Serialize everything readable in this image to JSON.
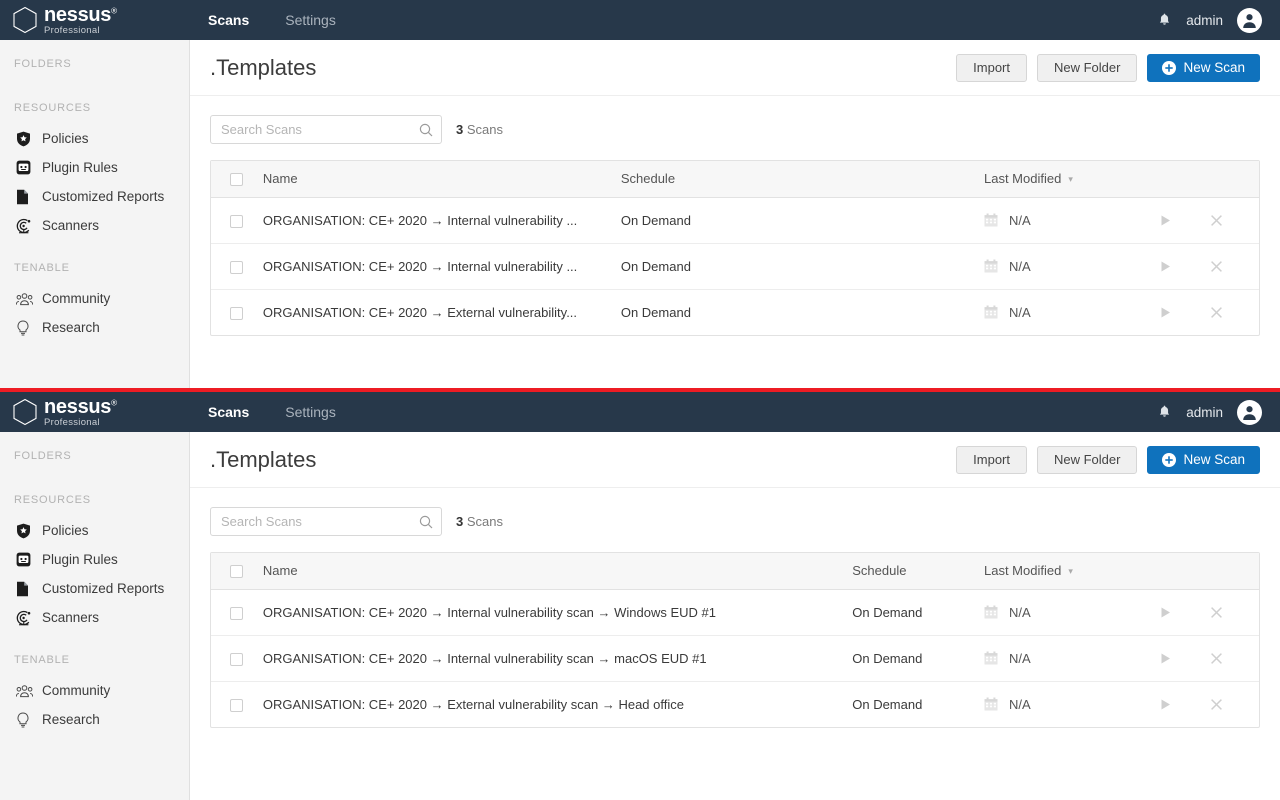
{
  "brand": {
    "name": "nessus",
    "registered": "®",
    "subtitle": "Professional"
  },
  "navbar": {
    "tabs": [
      {
        "label": "Scans",
        "active": true
      },
      {
        "label": "Settings",
        "active": false
      }
    ],
    "notifications_icon": "bell-icon",
    "username": "admin",
    "avatar_icon": "user-avatar-icon"
  },
  "sidebar": {
    "groups": [
      {
        "label": "FOLDERS",
        "items": []
      },
      {
        "label": "RESOURCES",
        "items": [
          {
            "label": "Policies",
            "icon": "shield-star-icon"
          },
          {
            "label": "Plugin Rules",
            "icon": "plugin-rules-icon"
          },
          {
            "label": "Customized Reports",
            "icon": "document-icon"
          },
          {
            "label": "Scanners",
            "icon": "scanner-radar-icon"
          }
        ]
      },
      {
        "label": "TENABLE",
        "items": [
          {
            "label": "Community",
            "icon": "community-people-icon"
          },
          {
            "label": "Research",
            "icon": "lightbulb-icon"
          }
        ]
      }
    ]
  },
  "page": {
    "title": ".Templates",
    "buttons": {
      "import": "Import",
      "new_folder": "New Folder",
      "new_scan": "New Scan"
    }
  },
  "toolbar": {
    "search_placeholder": "Search Scans",
    "search_value": "",
    "search_icon": "search-icon",
    "count_number": "3",
    "count_label": "Scans"
  },
  "table": {
    "columns": {
      "name": "Name",
      "schedule": "Schedule",
      "last_modified": "Last Modified",
      "sort_indicator": "▾"
    },
    "rows_truncated": [
      {
        "name": "ORGANISATION: CE+ 2020 → Internal vulnerability ...",
        "schedule": "On Demand",
        "last_modified": "N/A"
      },
      {
        "name": "ORGANISATION: CE+ 2020 → Internal vulnerability ...",
        "schedule": "On Demand",
        "last_modified": "N/A"
      },
      {
        "name": "ORGANISATION: CE+ 2020 → External vulnerability...",
        "schedule": "On Demand",
        "last_modified": "N/A"
      }
    ],
    "rows_full": [
      {
        "name": "ORGANISATION: CE+ 2020 → Internal vulnerability scan → Windows EUD #1",
        "schedule": "On Demand",
        "last_modified": "N/A"
      },
      {
        "name": "ORGANISATION: CE+ 2020 → Internal vulnerability scan → macOS EUD #1",
        "schedule": "On Demand",
        "last_modified": "N/A"
      },
      {
        "name": "ORGANISATION: CE+ 2020 → External vulnerability scan → Head office",
        "schedule": "On Demand",
        "last_modified": "N/A"
      }
    ],
    "row_actions": {
      "launch_icon": "play-icon",
      "delete_icon": "close-x-icon"
    },
    "calendar_icon": "calendar-icon"
  },
  "colors": {
    "navbar_bg": "#27384a",
    "separator_red": "#ed1c24",
    "primary_blue": "#0f72bd",
    "sidebar_bg": "#f4f4f4"
  }
}
